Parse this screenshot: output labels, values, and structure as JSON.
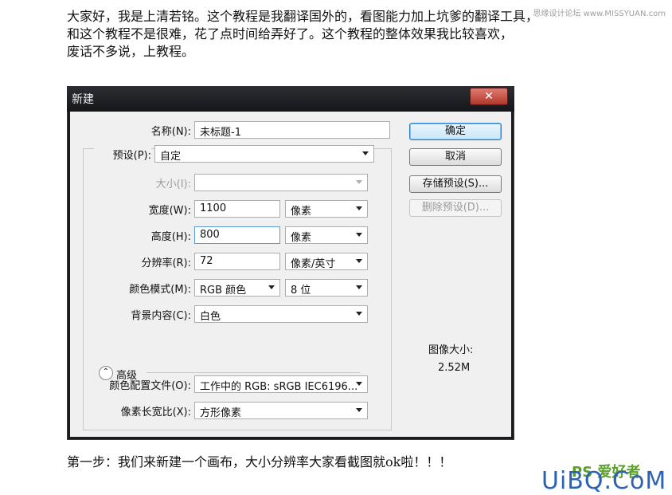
{
  "watermark_top": "思缘设计论坛 www.MISSYUAN.com",
  "intro_lines": [
    "大家好，我是上清若铭。这个教程是我翻译国外的，看图能力加上坑爹的翻译工具，",
    "和这个教程不是很难，花了点时间给弄好了。这个教程的整体效果我比较喜欢，",
    "废话不多说，上教程。"
  ],
  "dialog": {
    "title": "新建",
    "close_glyph": "✕",
    "name": {
      "label": "名称(N):",
      "value": "未标题-1"
    },
    "preset": {
      "label": "预设(P):",
      "value": "自定"
    },
    "size": {
      "label": "大小(I):",
      "value": ""
    },
    "width": {
      "label": "宽度(W):",
      "value": "1100",
      "unit": "像素"
    },
    "height": {
      "label": "高度(H):",
      "value": "800",
      "unit": "像素"
    },
    "resolution": {
      "label": "分辨率(R):",
      "value": "72",
      "unit": "像素/英寸"
    },
    "color_mode": {
      "label": "颜色模式(M):",
      "value": "RGB 颜色",
      "bits": "8 位"
    },
    "background": {
      "label": "背景内容(C):",
      "value": "白色"
    },
    "advanced_label": "高级",
    "color_profile": {
      "label": "颜色配置文件(O):",
      "value": "工作中的 RGB: sRGB IEC6196..."
    },
    "pixel_aspect": {
      "label": "像素长宽比(X):",
      "value": "方形像素"
    },
    "buttons": {
      "ok": "确定",
      "cancel": "取消",
      "save_preset": "存储预设(S)...",
      "delete_preset": "删除预设(D)..."
    },
    "image_size_label": "图像大小:",
    "image_size_value": "2.52M"
  },
  "step_text": "第一步：我们来新建一个画布，大小分辨率大家看截图就ok啦！！！",
  "logo_ps": "PS 爱好者",
  "logo_uibq": "UiBQ.CoM"
}
